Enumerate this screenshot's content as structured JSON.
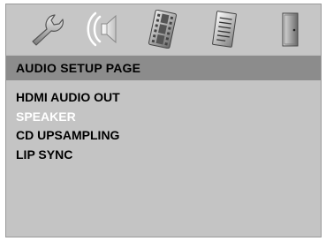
{
  "icon_bar": {
    "icons": [
      "wrench-icon",
      "speaker-icon",
      "film-strip-icon",
      "document-icon",
      "door-icon"
    ],
    "selected": "speaker-icon"
  },
  "page": {
    "title": "AUDIO SETUP PAGE"
  },
  "menu": {
    "items": [
      {
        "label": "HDMI AUDIO OUT"
      },
      {
        "label": "SPEAKER"
      },
      {
        "label": "CD UPSAMPLING"
      },
      {
        "label": "LIP SYNC"
      }
    ],
    "selected_index": 1
  },
  "colors": {
    "background": "#c4c4c4",
    "title_bar": "#8c8c8c",
    "selected_text": "#ffffff",
    "text": "#000000"
  }
}
